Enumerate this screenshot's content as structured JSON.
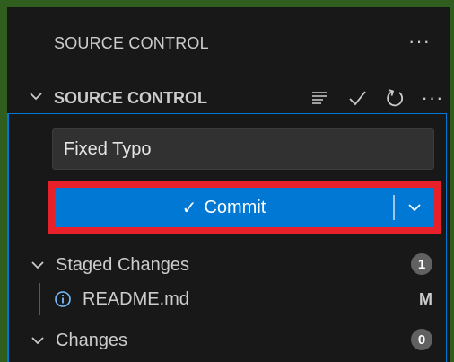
{
  "view": {
    "title": "SOURCE CONTROL",
    "more_label": "···"
  },
  "section": {
    "title": "SOURCE CONTROL",
    "actions": [
      "view-as-tree-icon",
      "commit-check-icon",
      "refresh-icon",
      "more-actions-icon"
    ],
    "more_label": "···"
  },
  "commit": {
    "message_value": "Fixed Typo",
    "button_check": "✓",
    "button_label": "Commit"
  },
  "groups": {
    "staged": {
      "label": "Staged Changes",
      "count": "1"
    },
    "changes": {
      "label": "Changes",
      "count": "0"
    }
  },
  "files": [
    {
      "name": "README.md",
      "status": "M",
      "icon": "info-icon"
    }
  ],
  "colors": {
    "accent": "#0078d4",
    "highlight_border": "#e8202a",
    "badge": "#616161",
    "frame": "#2f5e1f"
  }
}
